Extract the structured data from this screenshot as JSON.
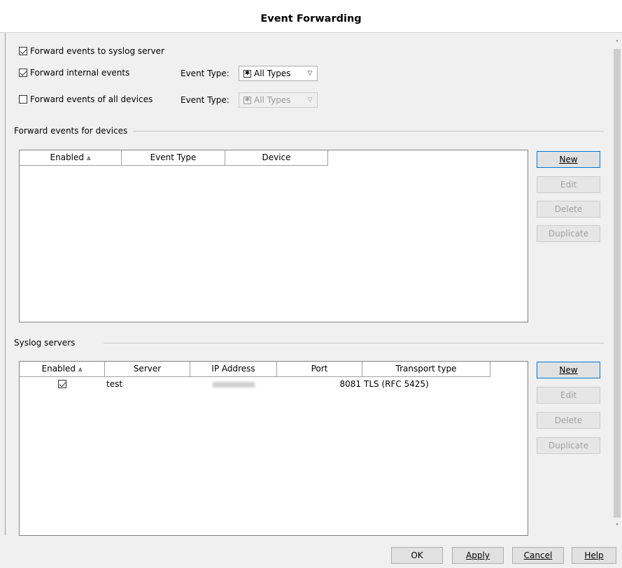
{
  "window": {
    "title": "Event Forwarding"
  },
  "options": {
    "forward_syslog": {
      "label": "Forward events to syslog server",
      "checked": true
    },
    "forward_internal": {
      "label": "Forward internal events",
      "checked": true,
      "event_type_label": "Event Type:",
      "event_type_value": "All Types"
    },
    "forward_all_devices": {
      "label": "Forward events of all devices",
      "checked": false,
      "event_type_label": "Event Type:",
      "event_type_value": "All Types"
    }
  },
  "devices_group": {
    "title": "Forward events for devices",
    "columns": [
      "Enabled",
      "Event Type",
      "Device"
    ],
    "rows": [],
    "buttons": {
      "new": "New",
      "edit": "Edit",
      "delete": "Delete",
      "duplicate": "Duplicate"
    }
  },
  "syslog_group": {
    "title": "Syslog servers",
    "columns": [
      "Enabled",
      "Server",
      "IP Address",
      "Port",
      "Transport type"
    ],
    "rows": [
      {
        "enabled": true,
        "server": "test",
        "ip": "",
        "port": "8081",
        "transport": "TLS (RFC 5425)"
      }
    ],
    "buttons": {
      "new": "New",
      "edit": "Edit",
      "delete": "Delete",
      "duplicate": "Duplicate"
    }
  },
  "footer": {
    "ok": "OK",
    "apply": "Apply",
    "cancel": "Cancel",
    "help": "Help"
  }
}
